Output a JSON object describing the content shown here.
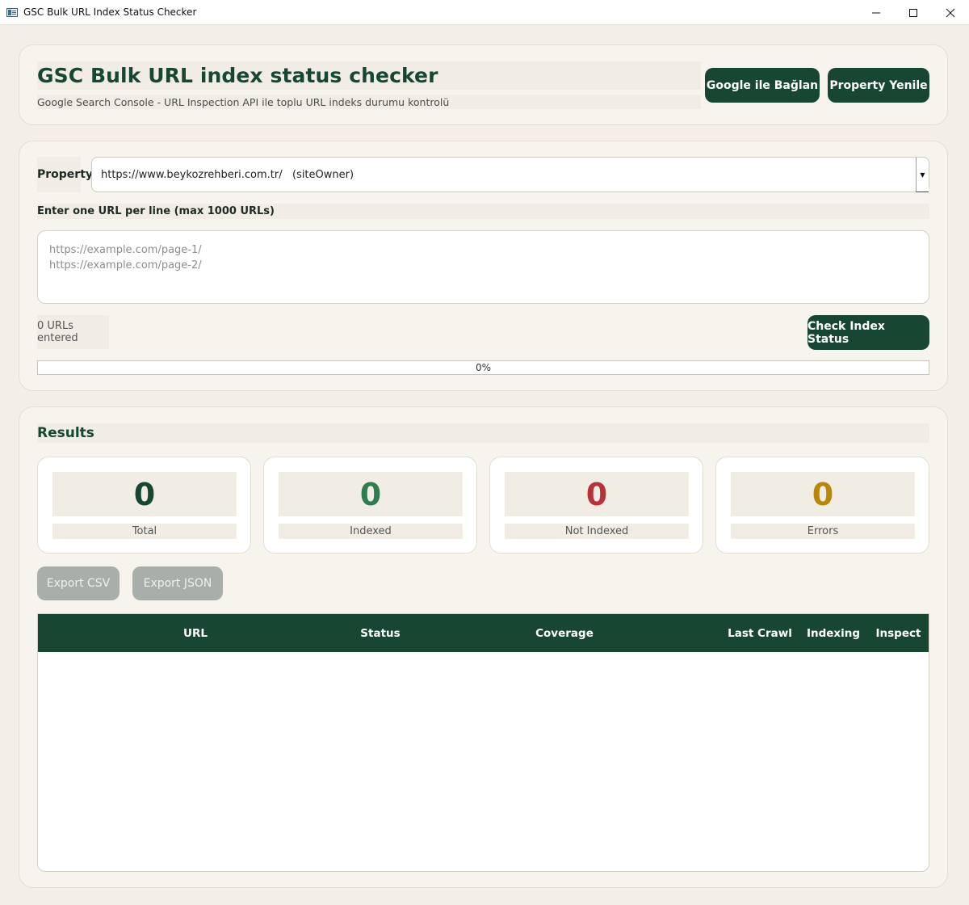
{
  "window": {
    "title": "GSC Bulk URL Index Status Checker"
  },
  "header": {
    "title": "GSC Bulk URL index status checker",
    "subtitle": "Google Search Console - URL Inspection API ile toplu URL indeks durumu kontrolü",
    "connect_label": "Google ile Bağlan",
    "refresh_label": "Property Yenile"
  },
  "input": {
    "property_label": "Property",
    "property_value": "https://www.beykozrehberi.com.tr/   (siteOwner)",
    "hint": "Enter one URL per line (max 1000 URLs)",
    "placeholder_lines": [
      "https://example.com/page-1/",
      "https://example.com/page-2/"
    ],
    "url_count": "0 URLs entered",
    "check_label": "Check Index Status",
    "progress_text": "0%",
    "progress_value": 0
  },
  "results": {
    "title": "Results",
    "stats": [
      {
        "value": "0",
        "label": "Total",
        "color": "#174733"
      },
      {
        "value": "0",
        "label": "Indexed",
        "color": "#2e7d4f"
      },
      {
        "value": "0",
        "label": "Not Indexed",
        "color": "#b8323a"
      },
      {
        "value": "0",
        "label": "Errors",
        "color": "#b8860b"
      }
    ],
    "export_csv": "Export CSV",
    "export_json": "Export JSON",
    "columns": [
      "URL",
      "Status",
      "Coverage",
      "Last Crawl",
      "Indexing",
      "Inspect"
    ]
  },
  "colors": {
    "accent": "#174733",
    "background": "#f3efe8"
  }
}
